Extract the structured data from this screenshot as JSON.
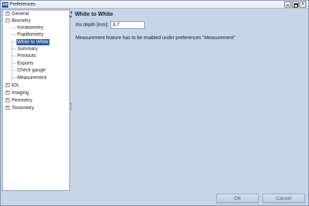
{
  "window": {
    "title": "Preferences",
    "icon_text": "EM",
    "close_glyph": "×"
  },
  "tree": {
    "items": [
      {
        "label": "General",
        "level": 0,
        "expander": "+"
      },
      {
        "label": "Biometry",
        "level": 0,
        "expander": "−"
      },
      {
        "label": "Keratometry",
        "level": 1
      },
      {
        "label": "Pupillometry",
        "level": 1
      },
      {
        "label": "White to White",
        "level": 1,
        "selected": true
      },
      {
        "label": "Summary",
        "level": 1
      },
      {
        "label": "Printouts",
        "level": 1
      },
      {
        "label": "Exports",
        "level": 1
      },
      {
        "label": "Check gauge",
        "level": 1
      },
      {
        "label": "Measurement",
        "level": 1
      },
      {
        "label": "IOL",
        "level": 0,
        "expander": "+"
      },
      {
        "label": "Imaging",
        "level": 0,
        "expander": "+"
      },
      {
        "label": "Perimetry",
        "level": 0,
        "expander": "+"
      },
      {
        "label": "Tonometry",
        "level": 0,
        "expander": "+"
      }
    ]
  },
  "panel": {
    "title": "White to White",
    "iris_depth_label": "Iris depth [mm]:",
    "iris_depth_value": "3.7",
    "notice": "Measurement feature has to be enabled under preferences \"Measurement\""
  },
  "buttons": {
    "ok": "OK",
    "cancel": "Cancel"
  },
  "colors": {
    "background": "#c7d5e6",
    "selection": "#2d5aa3"
  }
}
